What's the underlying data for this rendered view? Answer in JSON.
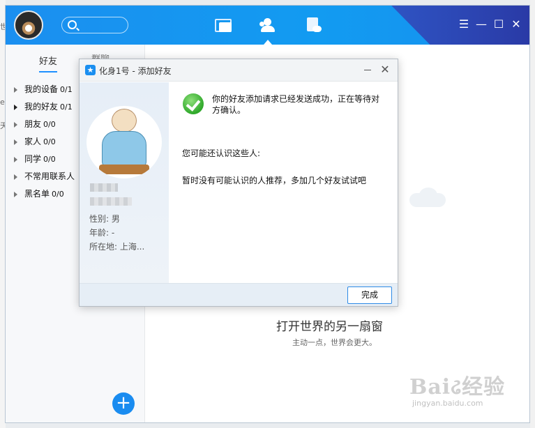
{
  "desktop": {
    "left_strips": [
      "世",
      "e",
      "天"
    ]
  },
  "main": {
    "nav": [
      "messages-icon",
      "contacts-icon",
      "space-icon"
    ],
    "tabs": {
      "friends": "好友",
      "groups": "群聊"
    },
    "groups": [
      {
        "name": "我的设备",
        "count": "0/1"
      },
      {
        "name": "我的好友",
        "count": "0/1"
      },
      {
        "name": "朋友",
        "count": "0/0"
      },
      {
        "name": "家人",
        "count": "0/0"
      },
      {
        "name": "同学",
        "count": "0/0"
      },
      {
        "name": "不常用联系人",
        "count": ""
      },
      {
        "name": "黑名单",
        "count": "0/0"
      }
    ],
    "fab_label": "+",
    "slogan": "打开世界的另一扇窗",
    "sub_slogan": "主动一点，世界会更大。"
  },
  "watermark": {
    "brand": "Baiઢ经验",
    "url": "jingyan.baidu.com"
  },
  "dialog": {
    "title": "化身1号 - 添加好友",
    "profile": {
      "sex": "性别: 男",
      "age": "年龄:  -",
      "location": "所在地: 上海..."
    },
    "success_message": "你的好友添加请求已经发送成功，正在等待对方确认。",
    "maybe_know": "您可能还认识这些人:",
    "no_recommend": "暂时没有可能认识的人推荐，多加几个好友试试吧",
    "done_button": "完成"
  },
  "colors": {
    "accent": "#1b8ff0",
    "title_dark": "#2a3aa6",
    "success": "#2fa82a"
  }
}
